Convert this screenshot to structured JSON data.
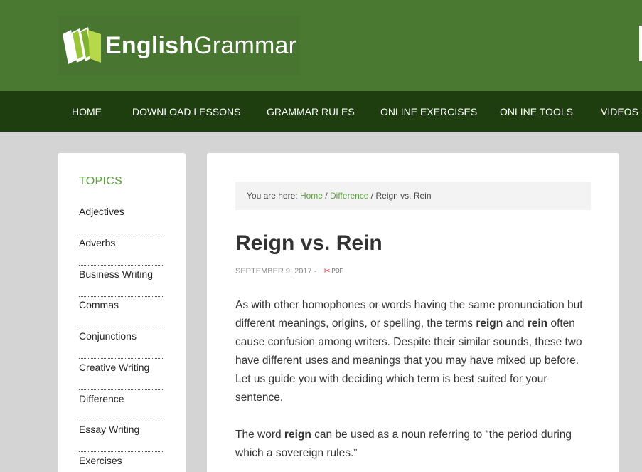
{
  "header": {
    "logo_bold": "English",
    "logo_light": "Grammar"
  },
  "nav": {
    "items": [
      "HOME",
      "DOWNLOAD LESSONS",
      "GRAMMAR RULES",
      "ONLINE EXERCISES",
      "ONLINE TOOLS",
      "VIDEOS"
    ]
  },
  "sidebar": {
    "title": "TOPICS",
    "items": [
      "Adjectives",
      "Adverbs",
      "Business Writing",
      "Commas",
      "Conjunctions",
      "Creative Writing",
      "Difference",
      "Essay Writing",
      "Exercises"
    ]
  },
  "breadcrumb": {
    "prefix": "You are here: ",
    "home": "Home",
    "sep1": " / ",
    "category": "Difference",
    "sep2": " / ",
    "current": "Reign vs. Rein"
  },
  "article": {
    "title": "Reign vs. Rein",
    "date": "SEPTEMBER 9, 2017 -",
    "pdf_label": "PDF",
    "p1": {
      "t1": "As with other homophones or words having the same pronunciation but different meanings, origins, or spelling, the terms ",
      "b1": "reign",
      "t2": " and ",
      "b2": "rein",
      "t3": " often cause confusion among writers. Despite their similar sounds, these two have different uses and meanings that you may have mixed up before. Let us guide you with deciding which term is best suited for your sentence."
    },
    "p2": {
      "t1": "The word ",
      "b1": "reign",
      "t2": " can be used as a noun referring to “the period during which a sovereign rules.”"
    }
  },
  "colors": {
    "header_green": "#4a7a32",
    "nav_dark_green": "#1e3e10",
    "accent_green": "#5aa03c",
    "page_bg": "#d4d4d4"
  },
  "icons": {
    "logo": "book-stack-logo-icon",
    "pdf": "pdf-icon"
  }
}
